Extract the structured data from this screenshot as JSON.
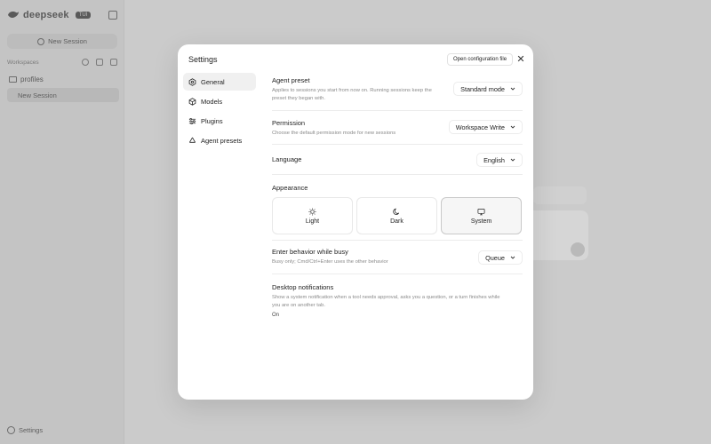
{
  "app": {
    "brand": "deepseek",
    "badge": "TUI",
    "new_session": "New Session",
    "workspaces_label": "Workspaces",
    "project": "profiles",
    "session": "New Session",
    "settings": "Settings"
  },
  "modal": {
    "title": "Settings",
    "open_config": "Open configuration file",
    "nav": [
      {
        "label": "General",
        "icon": "hexagon-icon"
      },
      {
        "label": "Models",
        "icon": "cube-icon"
      },
      {
        "label": "Plugins",
        "icon": "sliders-icon"
      },
      {
        "label": "Agent presets",
        "icon": "recycle-icon"
      }
    ],
    "agent_preset": {
      "title": "Agent preset",
      "desc": "Applies to sessions you start from now on. Running sessions keep the preset they began with.",
      "value": "Standard mode"
    },
    "permission": {
      "title": "Permission",
      "desc": "Choose the default permission mode for new sessions",
      "value": "Workspace Write"
    },
    "language": {
      "title": "Language",
      "value": "English"
    },
    "appearance": {
      "title": "Appearance",
      "options": [
        "Light",
        "Dark",
        "System"
      ],
      "selected": "System"
    },
    "enter_behavior": {
      "title": "Enter behavior while busy",
      "desc": "Busy only; Cmd/Ctrl+Enter uses the other behavior",
      "value": "Queue"
    },
    "notifications": {
      "title": "Desktop notifications",
      "desc": "Show a system notification when a tool needs approval, asks you a question, or a turn finishes while you are on another tab.",
      "value": "On"
    }
  }
}
